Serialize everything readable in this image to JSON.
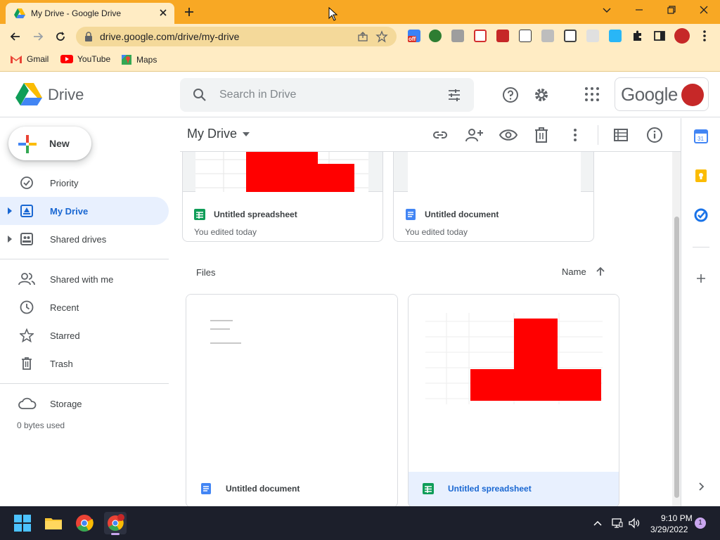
{
  "browser": {
    "tab_title": "My Drive - Google Drive",
    "url": "drive.google.com/drive/my-drive",
    "bookmarks": [
      {
        "label": "Gmail",
        "icon": "gmail-icon"
      },
      {
        "label": "YouTube",
        "icon": "youtube-icon"
      },
      {
        "label": "Maps",
        "icon": "maps-icon"
      }
    ],
    "extension_badge": "off"
  },
  "drive": {
    "app_name": "Drive",
    "search_placeholder": "Search in Drive",
    "account_label": "Google",
    "new_button": "New",
    "nav": [
      {
        "label": "Priority",
        "icon": "priority-icon"
      },
      {
        "label": "My Drive",
        "icon": "my-drive-icon",
        "active": true
      },
      {
        "label": "Shared drives",
        "icon": "shared-drives-icon"
      },
      {
        "label": "Shared with me",
        "icon": "shared-with-me-icon"
      },
      {
        "label": "Recent",
        "icon": "recent-icon"
      },
      {
        "label": "Starred",
        "icon": "star-icon"
      },
      {
        "label": "Trash",
        "icon": "trash-icon"
      },
      {
        "label": "Storage",
        "icon": "cloud-icon"
      }
    ],
    "storage_used": "0 bytes used",
    "breadcrumb": "My Drive",
    "suggested": [
      {
        "title": "Untitled spreadsheet",
        "subtitle": "You edited today",
        "type": "spreadsheet"
      },
      {
        "title": "Untitled document",
        "subtitle": "You edited today",
        "type": "document"
      }
    ],
    "files_label": "Files",
    "sort_label": "Name",
    "files": [
      {
        "title": "Untitled document",
        "type": "document",
        "selected": false
      },
      {
        "title": "Untitled spreadsheet",
        "type": "spreadsheet",
        "selected": true
      }
    ]
  },
  "taskbar": {
    "time": "9:10 PM",
    "date": "3/29/2022",
    "notification_count": "1"
  },
  "colors": {
    "chrome_frame": "#f8a824",
    "chrome_toolbar": "#ffecc4",
    "drive_active": "#e8f0fe",
    "drive_blue": "#1967d2",
    "sheets_green": "#0f9d58",
    "docs_blue": "#4285f4",
    "thumb_red": "#ff0000",
    "taskbar": "#1c1f2b"
  }
}
